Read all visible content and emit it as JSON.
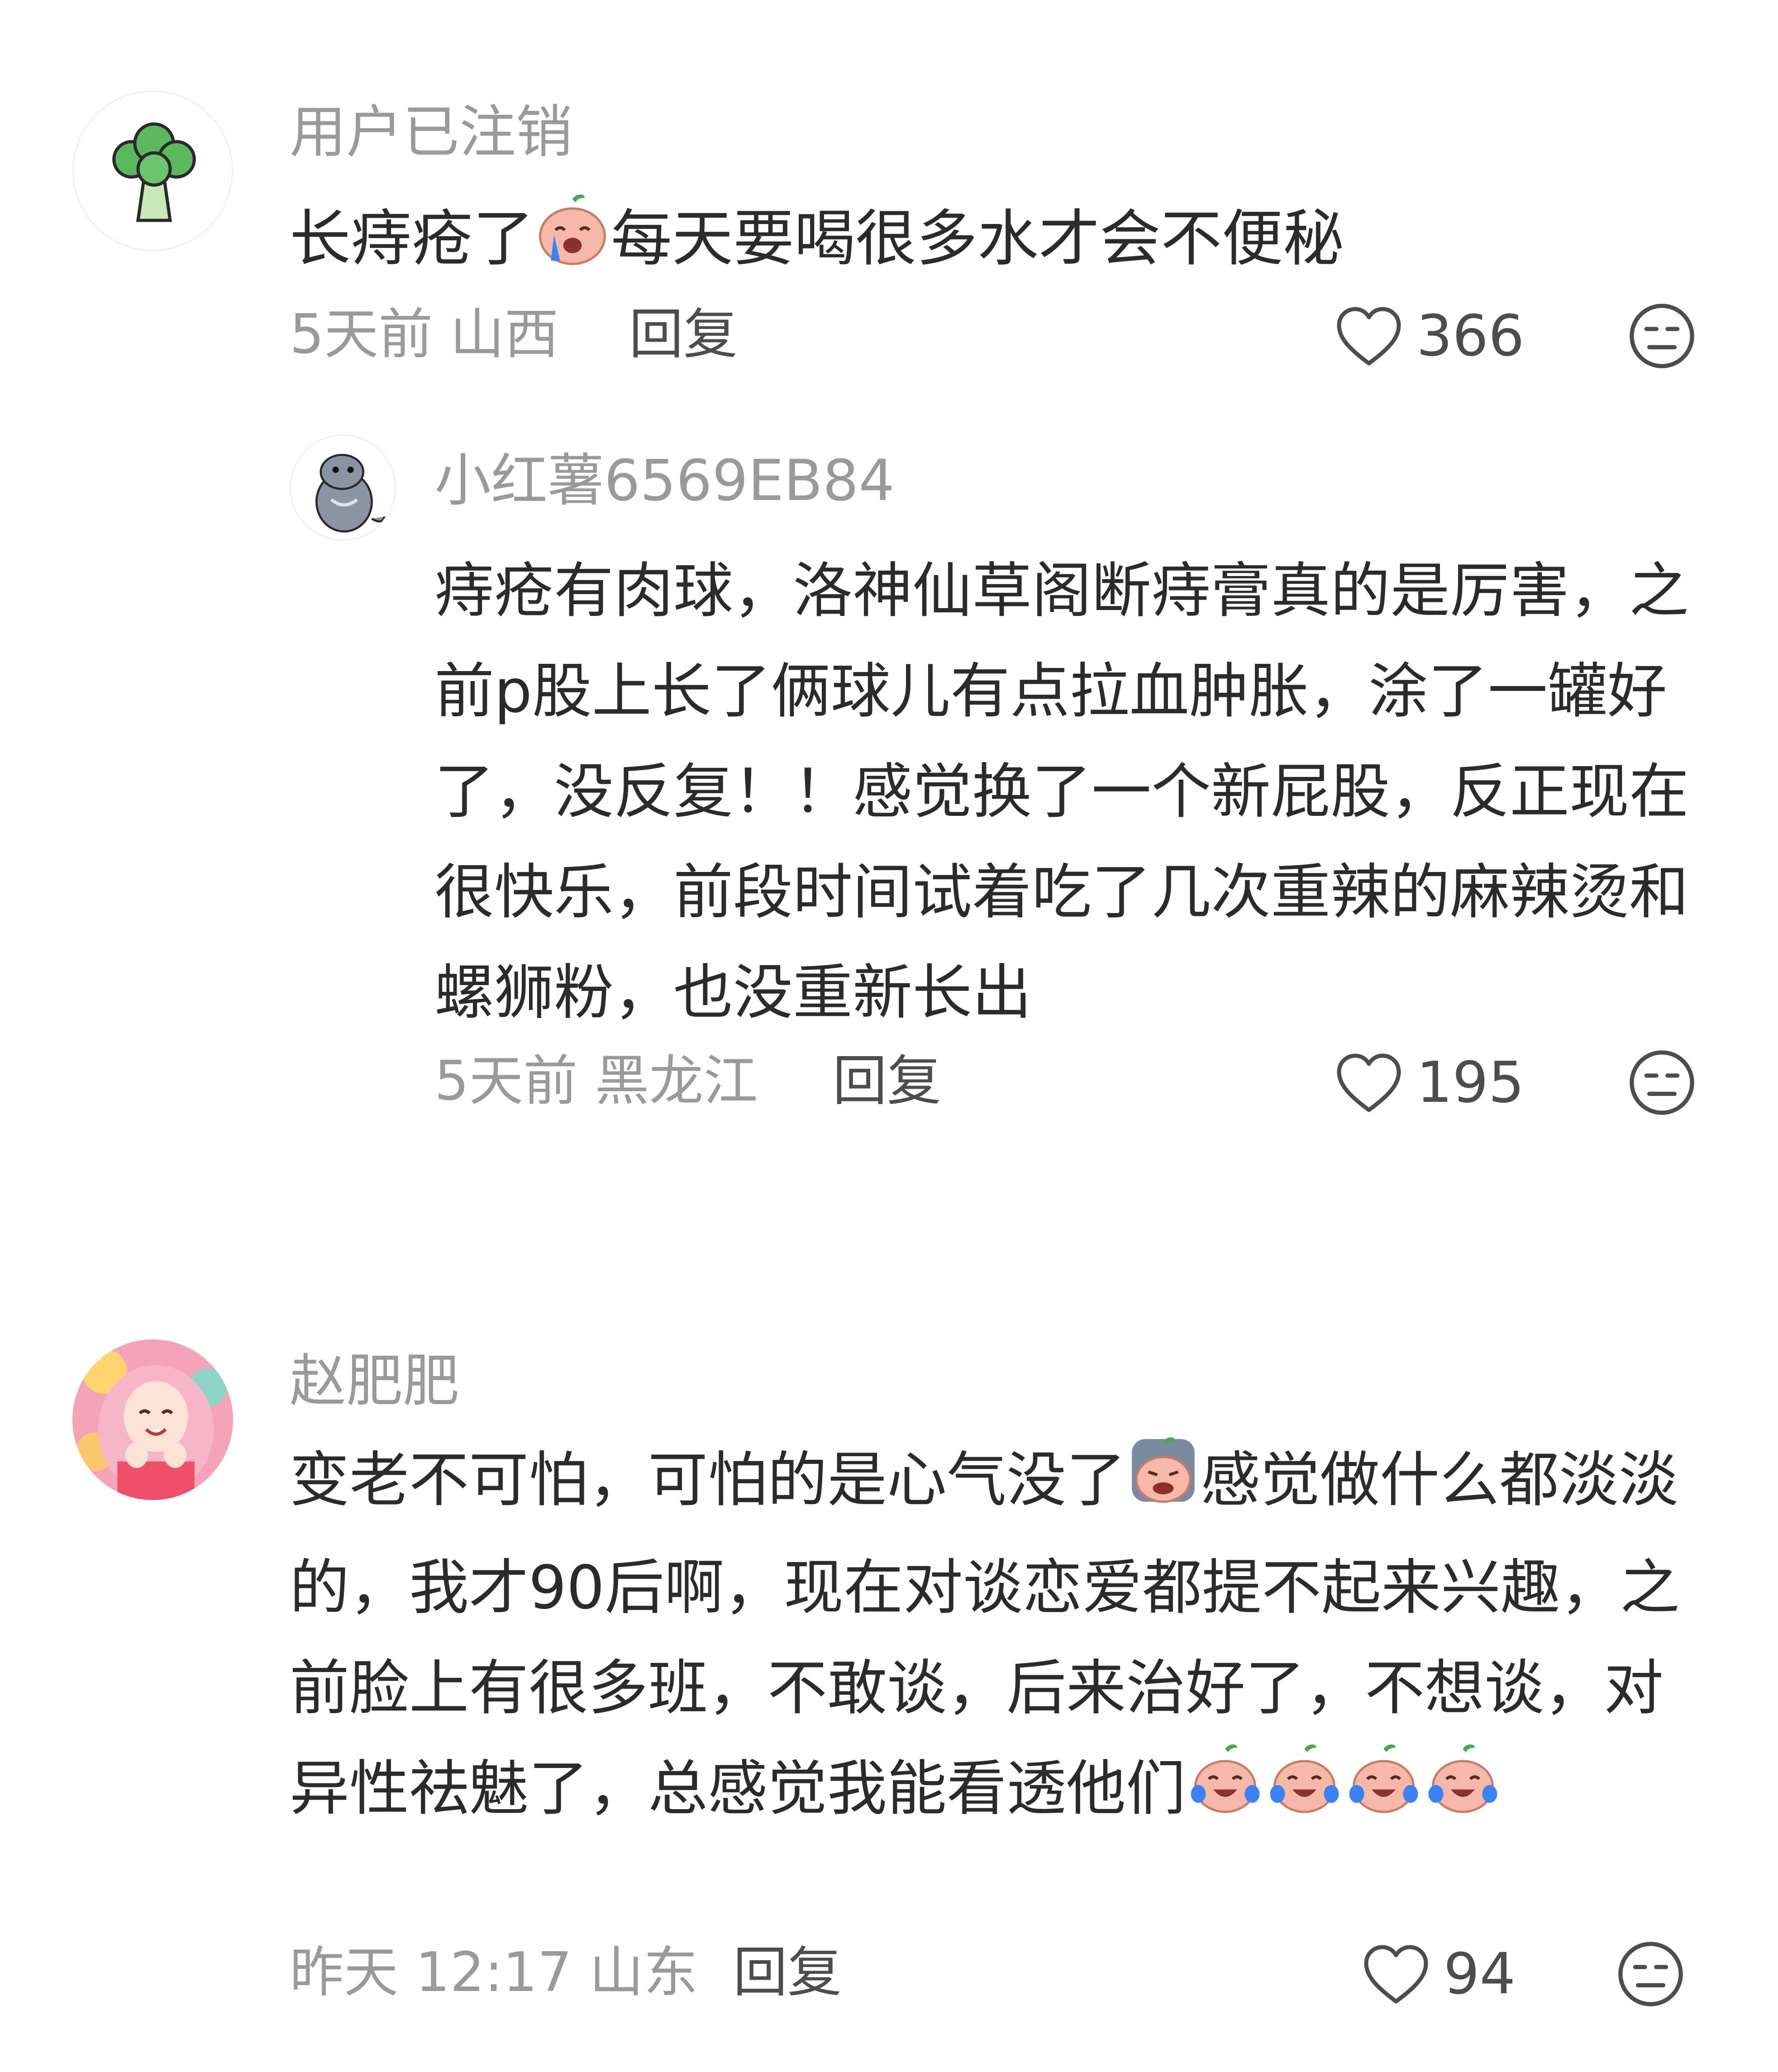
{
  "comments": [
    {
      "username": "用户已注销",
      "text_a": "长痔疮了",
      "emoji_1": "crying-face-icon",
      "text_b": "每天要喝很多水才会不便秘",
      "time_location": "5天前 山西",
      "reply_label": "回复",
      "likes": "366",
      "avatar_icon": "broccoli-icon",
      "reply": {
        "username": "小红薯6569EB84",
        "text": "痔疮有肉球，洛神仙草阁断痔膏真的是厉害，之前p股上长了俩球儿有点拉血肿胀，涂了一罐好了，没反复！！感觉换了一个新屁股，反正现在很快乐，前段时间试着吃了几次重辣的麻辣烫和螺狮粉，也没重新长出",
        "time_location": "5天前 黑龙江",
        "reply_label": "回复",
        "likes": "195",
        "avatar_icon": "seal-avatar-icon"
      }
    },
    {
      "username": "赵肥肥",
      "text_a": "变老不可怕，可怕的是心气没了",
      "emoji_1": "sad-face-icon",
      "text_b": "感觉做什么都淡淡的，我才90后啊，现在对谈恋爱都提不起来兴趣，之前脸上有很多班，不敢谈，后来治好了，不想谈，对异性祛魅了，总感觉我能看透他们",
      "emoji_trailing": "laugh-cry-face-icon",
      "time_location": "昨天 12:17 山东",
      "reply_label": "回复",
      "likes": "94",
      "avatar_icon": "girl-avatar-icon"
    }
  ],
  "colors": {
    "meta_gray": "#9a9a9a",
    "text_dark": "#2b2b2b",
    "icon_gray": "#4d4d4d",
    "emoji_peach": "#f6b8a8",
    "emoji_blue": "#3b82f6",
    "emoji_green": "#3fae4a"
  }
}
